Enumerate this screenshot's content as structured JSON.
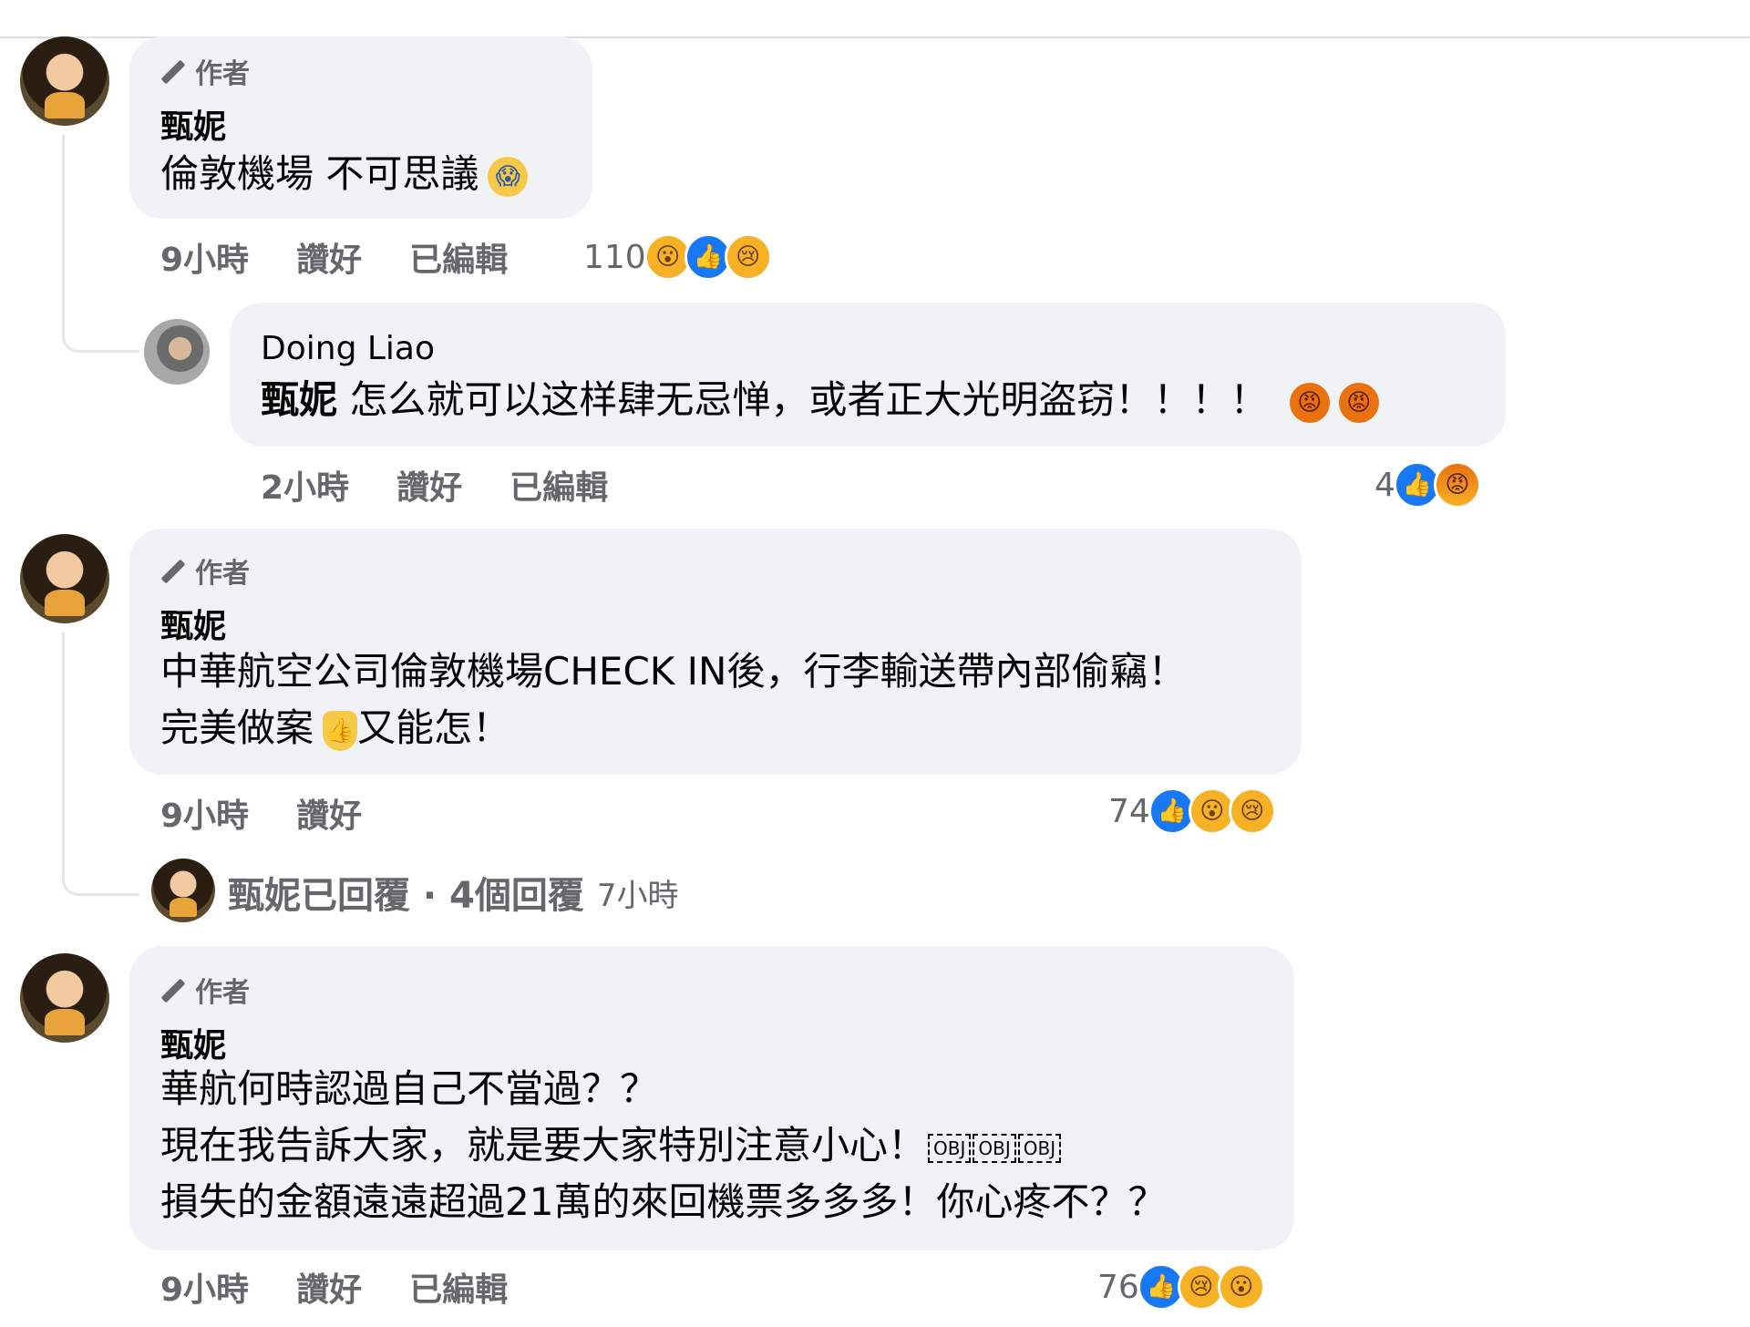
{
  "author_tag": "作者",
  "comments": [
    {
      "name": "甄妮",
      "text": "倫敦機場 不可思議",
      "emoji": "😱",
      "meta": {
        "time": "9小時",
        "like": "讚好",
        "edited": "已編輯"
      },
      "reactions": {
        "count": "110",
        "icons": [
          "wow-icon",
          "like-icon",
          "sad-icon"
        ]
      },
      "reply": {
        "name": "Doing Liao",
        "mention": "甄妮",
        "text": "怎么就可以这样肆无忌惮，或者正大光明盗窃！！！！",
        "emojis": [
          "😡",
          "😡"
        ],
        "meta": {
          "time": "2小時",
          "like": "讚好",
          "edited": "已編輯"
        },
        "reactions": {
          "count": "4",
          "icons": [
            "like-icon",
            "angry-icon"
          ]
        }
      }
    },
    {
      "name": "甄妮",
      "lines": [
        "中華航空公司倫敦機場CHECK IN後，行李輸送帶內部偷竊！",
        "完美做案",
        "又能怎！"
      ],
      "emoji": "👍",
      "meta": {
        "time": "9小時",
        "like": "讚好"
      },
      "reactions": {
        "count": "74",
        "icons": [
          "like-icon",
          "wow-icon",
          "sad-icon"
        ]
      },
      "replies_summary": {
        "label": "甄妮已回覆 · 4個回覆",
        "time": "7小時"
      }
    },
    {
      "name": "甄妮",
      "lines": [
        "華航何時認過自己不當過？？",
        "現在我告訴大家，就是要大家特別注意小心！",
        "損失的金額遠遠超過21萬的來回機票多多多！你心疼不？？"
      ],
      "obj": "OBJ",
      "meta": {
        "time": "9小時",
        "like": "讚好",
        "edited": "已編輯"
      },
      "reactions": {
        "count": "76",
        "icons": [
          "like-icon",
          "sad-icon",
          "wow-icon"
        ]
      }
    }
  ]
}
